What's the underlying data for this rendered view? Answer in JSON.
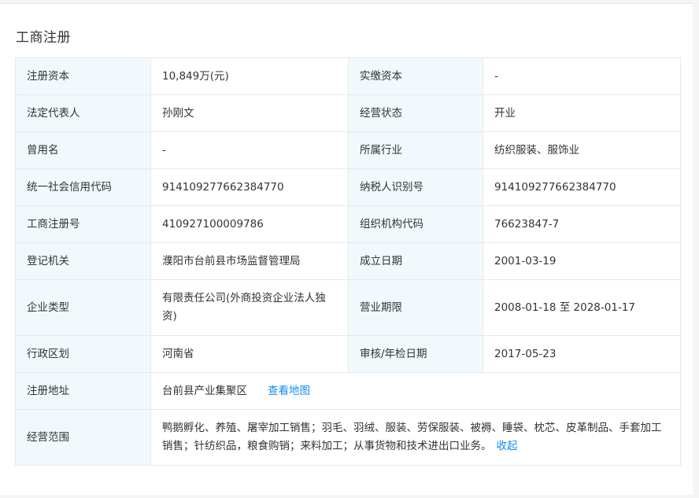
{
  "section_title": "工商注册",
  "rows": [
    {
      "l1": "注册资本",
      "v1": "10,849万(元)",
      "l2": "实缴资本",
      "v2": "-"
    },
    {
      "l1": "法定代表人",
      "v1": "孙刚文",
      "l2": "经营状态",
      "v2": "开业"
    },
    {
      "l1": "曾用名",
      "v1": "-",
      "l2": "所属行业",
      "v2": "纺织服装、服饰业"
    },
    {
      "l1": "统一社会信用代码",
      "v1": "914109277662384770",
      "l2": "纳税人识别号",
      "v2": "914109277662384770"
    },
    {
      "l1": "工商注册号",
      "v1": "410927100009786",
      "l2": "组织机构代码",
      "v2": "76623847-7"
    },
    {
      "l1": "登记机关",
      "v1": "濮阳市台前县市场监督管理局",
      "l2": "成立日期",
      "v2": "2001-03-19"
    },
    {
      "l1": "企业类型",
      "v1": "有限责任公司(外商投资企业法人独资)",
      "l2": "营业期限",
      "v2": "2008-01-18 至 2028-01-17"
    },
    {
      "l1": "行政区划",
      "v1": "河南省",
      "l2": "审核/年检日期",
      "v2": "2017-05-23"
    }
  ],
  "address": {
    "label": "注册地址",
    "value": "台前县产业集聚区",
    "map_link": "查看地图"
  },
  "scope": {
    "label": "经营范围",
    "value": "鸭鹅孵化、养殖、屠宰加工销售；羽毛、羽绒、服装、劳保服装、被褥、睡袋、枕芯、皮革制品、手套加工销售；针纺织品，粮食购销；来料加工；从事货物和技术进出口业务。",
    "collapse_link": "收起"
  },
  "colors": {
    "label_bg": "#f2f9fc",
    "border": "#e4e9ee",
    "link": "#128bed"
  }
}
